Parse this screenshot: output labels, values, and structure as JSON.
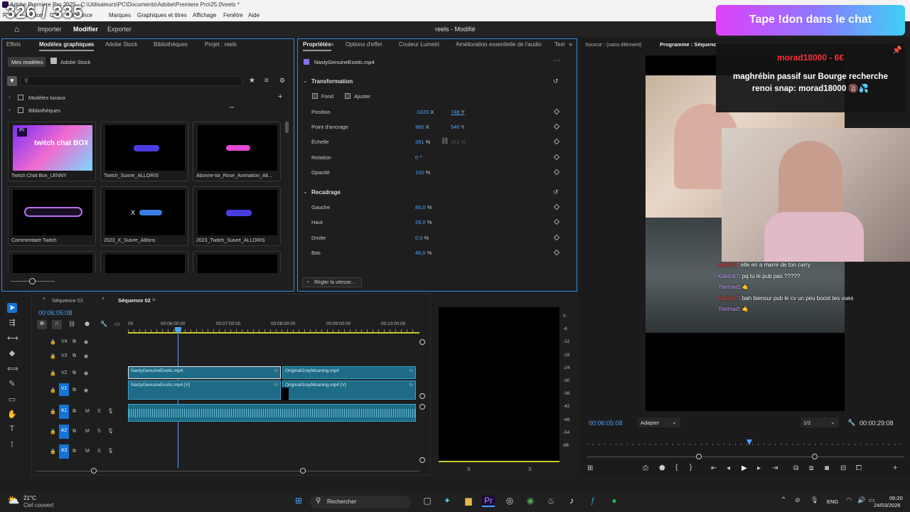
{
  "window": {
    "title": "Adobe Premiere Pro 2025 - C:\\Utilisateurs\\PC\\Documents\\Adobe\\Premiere Pro\\25.0\\reels *",
    "counter": "326 / 335"
  },
  "menu": [
    "Fichier",
    "Édition",
    "Clip",
    "Séquence",
    "Marques",
    "Graphiques et titres",
    "Affichage",
    "Fenêtre",
    "Aide"
  ],
  "workspace": {
    "items": [
      "Importer",
      "Modifier",
      "Exporter"
    ],
    "active": "Modifier",
    "project_title": "reels - Modifié"
  },
  "left_panel": {
    "tabs": [
      "Effets",
      "Modèles graphiques",
      "Adobe Stock",
      "Bibliothèques",
      "Projet : reels"
    ],
    "subtabs": [
      "Mes modèles",
      "Adobe Stock"
    ],
    "search_placeholder": "",
    "tree": [
      "Modèles locaux",
      "Bibliothèques"
    ],
    "tiles": [
      {
        "label": "Twitch Chat Box_LENNY",
        "thumb_text": "twitch chat BOX",
        "style": "purple"
      },
      {
        "label": "Twitch_Suivre_ALLORIS",
        "thumb_text": "",
        "style": "dark"
      },
      {
        "label": "Abonne-toi_Rose_Animation_All...",
        "thumb_text": "",
        "style": "dark"
      },
      {
        "label": "Commentaire Twitch",
        "thumb_text": "",
        "style": "dark"
      },
      {
        "label": "2023_X_Suivre_Allloris",
        "thumb_text": "X",
        "style": "dark"
      },
      {
        "label": "2023_Twitch_Suivre_ALLORIS",
        "thumb_text": "",
        "style": "dark"
      }
    ]
  },
  "properties": {
    "tabs": [
      "Propriétés",
      "Options d'effet",
      "Couleur Lumetri",
      "Amélioration essentielle de l'audio",
      "Texte"
    ],
    "clip_name": "NastyGenuineExotic.mp4",
    "transform_title": "Transformation",
    "fill_options": [
      "Fond",
      "Ajuster"
    ],
    "rows": [
      {
        "label": "Position",
        "v1": "-1620",
        "u1": "X",
        "v2": "748",
        "u2": "Y"
      },
      {
        "label": "Point d'ancrage",
        "v1": "960",
        "u1": "X",
        "v2": "540",
        "u2": "Y"
      },
      {
        "label": "Échelle",
        "v1": "281",
        "u1": "%",
        "v2": "281",
        "u2": "%"
      },
      {
        "label": "Rotation",
        "v1": "0",
        "u1": "°",
        "v2": "",
        "u2": ""
      },
      {
        "label": "Opacité",
        "v1": "100",
        "u1": "%",
        "v2": "",
        "u2": ""
      }
    ],
    "crop_title": "Recadrage",
    "crop_rows": [
      {
        "label": "Gauche",
        "v": "80,0",
        "u": "%"
      },
      {
        "label": "Haut",
        "v": "29,0",
        "u": "%"
      },
      {
        "label": "Droite",
        "v": "0,0",
        "u": "%"
      },
      {
        "label": "Bas",
        "v": "46,0",
        "u": "%"
      }
    ],
    "speed_button": "Régler la vitesse..."
  },
  "monitor": {
    "source_tab": "Source : (sans élément)",
    "program_tab": "Programme : Séquence 02",
    "timecode": "00:06:05:08",
    "fit": "Adapter",
    "quality": "1/2",
    "duration": "00:00:29:08"
  },
  "overlay": {
    "banner": "Tape !don dans le chat",
    "donation": "morad18000 - 6€",
    "donation_msg": "maghrébin passif sur Bourge recherche renoi snap: morad18000 🔞💦",
    "chat": [
      {
        "user": "eiik 951",
        "msg": ": elle en a marre de ton carry"
      },
      {
        "user": "Kaido67",
        "msg": ": pq tu le pub pas ?????"
      },
      {
        "user": "Yanmad",
        "msg": ": 🤙"
      },
      {
        "user": "Kaido67",
        "msg": ": bah biensur pub le cv un peu boost tes vues"
      },
      {
        "user": "Yanmad",
        "msg": ": 🤙"
      }
    ]
  },
  "timeline": {
    "tabs": [
      "Séquence 01",
      "Séquence 02"
    ],
    "timecode": "00:06:05:08",
    "ruler": [
      "00",
      "00:06:00:00",
      "00:07:00:00",
      "00:08:00:00",
      "00:09:00:00",
      "00:10:00:00"
    ],
    "tracks": [
      "V4",
      "V3",
      "V2",
      "V1",
      "A1",
      "A2",
      "A3"
    ],
    "clips": {
      "v2a": "NastyGenuineExotic.mp4",
      "v2b": "OriginalGrayMoaning.mp4",
      "v1a": "NastyGenuineExotic.mp4 [V]",
      "v1b": "OriginalGrayMoaning.mp4 [V]"
    }
  },
  "meter": {
    "scale": [
      "0",
      "-6",
      "-12",
      "-18",
      "-24",
      "-30",
      "-36",
      "-42",
      "-48",
      "-54",
      "dB"
    ],
    "channels": [
      "S",
      "S"
    ]
  },
  "taskbar": {
    "temp": "21°C",
    "weather": "Ciel couvert",
    "search": "Rechercher",
    "lang": "ENG",
    "time": "06:20",
    "date": "24/03/2026"
  },
  "colors": {
    "accent": "#2d8ceb",
    "value": "#4aa3ff",
    "clip": "#1d6b86",
    "track_blue": "#1473d4",
    "banner_from": "#e040fb",
    "banner_to": "#3fd0f5"
  }
}
